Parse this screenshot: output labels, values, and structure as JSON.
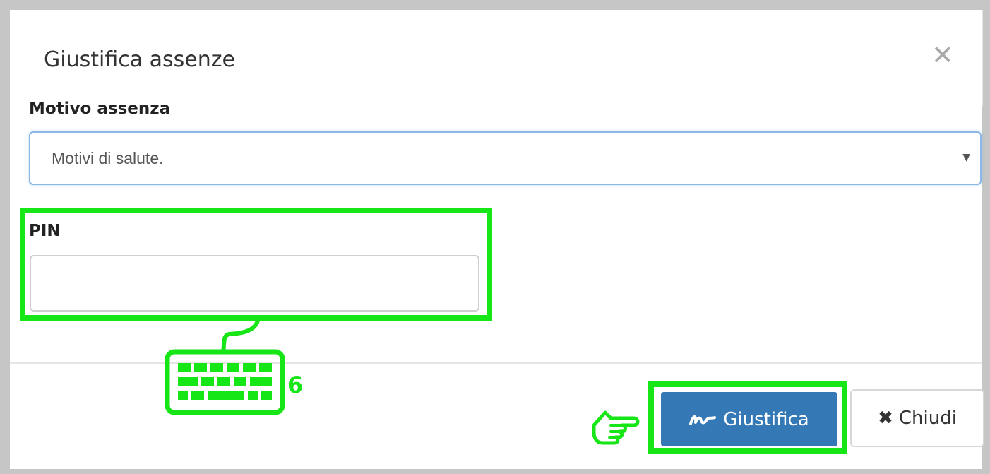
{
  "dialog": {
    "title": "Giustifica assenze",
    "close_icon": "close-icon"
  },
  "form": {
    "reason_label": "Motivo assenza",
    "reason_value": "Motivi di salute.",
    "pin_label": "PIN",
    "pin_value": "",
    "pin_placeholder": ""
  },
  "footer": {
    "justify_label": "Giustifica",
    "justify_icon": "signature-icon",
    "close_label": "Chiudi",
    "close_icon": "times-icon"
  },
  "annotations": {
    "step_number": "6",
    "keyboard_icon": "keyboard-icon",
    "pointer_icon": "pointing-hand-icon",
    "highlight_color": "#16e516"
  },
  "colors": {
    "primary_button": "#3478b6",
    "focus_border": "#8cb6e6"
  }
}
